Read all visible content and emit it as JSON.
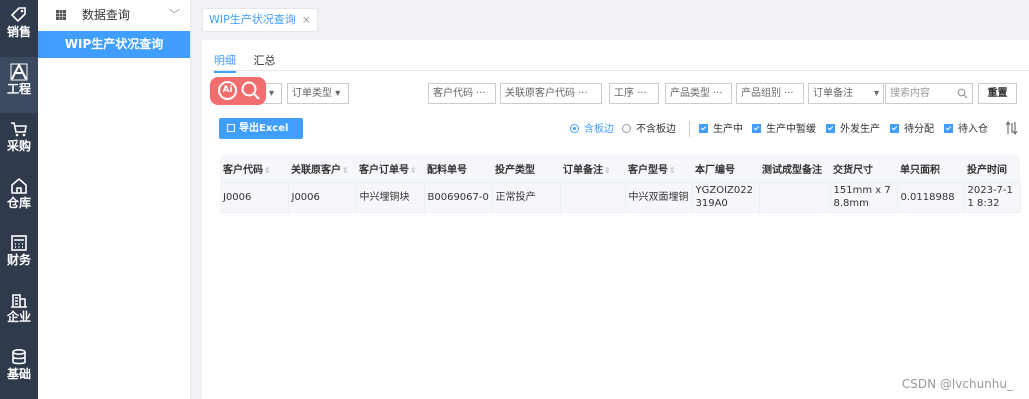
{
  "rail": [
    {
      "label": "销售",
      "icon": "tag-icon"
    },
    {
      "label": "工程",
      "icon": "engineering-icon"
    },
    {
      "label": "采购",
      "icon": "cart-icon"
    },
    {
      "label": "仓库",
      "icon": "warehouse-icon"
    },
    {
      "label": "财务",
      "icon": "calculator-icon"
    },
    {
      "label": "企业",
      "icon": "building-icon"
    },
    {
      "label": "基础",
      "icon": "database-icon"
    }
  ],
  "subnav": {
    "group_label": "数据查询",
    "item_label": "WIP生产状况查询"
  },
  "page_tab": {
    "label": "WIP生产状况查询",
    "close": "×"
  },
  "sub_tabs": [
    "明细",
    "汇总"
  ],
  "filters": {
    "order_type": "订单类型",
    "customer_code": "客户代码",
    "related_customer_code": "关联原客户代码",
    "process": "工序",
    "product_type": "产品类型",
    "product_group": "产品组别",
    "order_note": "订单备注",
    "search_placeholder": "搜索内容",
    "reset_label": "重置",
    "dots": "···"
  },
  "export_label": "导出Excel",
  "options": {
    "radio_include": "含板边",
    "radio_exclude": "不含板边",
    "chk_producing": "生产中",
    "chk_paused": "生产中暂缓",
    "chk_outsourced": "外发生产",
    "chk_pending_assign": "待分配",
    "chk_pending_stock": "待入仓"
  },
  "table": {
    "headers": [
      "客户代码",
      "关联原客户",
      "客户订单号",
      "配料单号",
      "投产类型",
      "订单备注",
      "客户型号",
      "本厂编号",
      "测试成型备注",
      "交货尺寸",
      "单只面积",
      "投产时间"
    ],
    "rows": [
      [
        "J0006",
        "J0006",
        "中兴埋铜块",
        "B0069067-0",
        "正常投产",
        "",
        "中兴双面埋铜",
        "YGZOIZ022319A0",
        "",
        "151mm x 78.8mm",
        "0.0118988",
        "2023-7-11 8:32"
      ]
    ]
  },
  "watermark": "CSDN @lvchunhu_",
  "colors": {
    "accent": "#409eff",
    "rail": "#2f3b4c",
    "ai_badge": "#f26d6d"
  }
}
